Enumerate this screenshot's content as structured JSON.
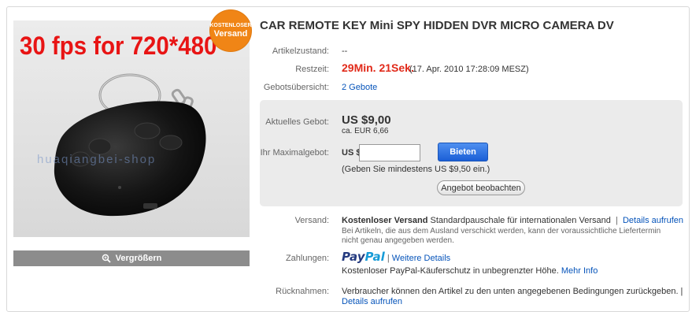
{
  "listing": {
    "title": "CAR REMOTE KEY Mini SPY HIDDEN DVR MICRO CAMERA DV",
    "badge_top": "KOSTENLOSER",
    "badge_bottom": "Versand",
    "image_text": "30 fps for 720*480",
    "watermark": "huaqiangbei-shop",
    "enlarge_label": "Vergrößern"
  },
  "details": {
    "condition_label": "Artikelzustand:",
    "condition_value": "--",
    "time_label": "Restzeit:",
    "time_left": "29Min. 21Sek.",
    "end_time": "(17. Apr. 2010  17:28:09 MESZ)",
    "bids_label": "Gebotsübersicht:",
    "bids_link": "2 Gebote"
  },
  "bid": {
    "current_label": "Aktuelles Gebot:",
    "current_price": "US $9,00",
    "approx_price": "ca. EUR 6,66",
    "max_label": "Ihr Maximalgebot:",
    "currency_prefix": "US $",
    "input_value": "",
    "bid_button": "Bieten",
    "min_hint": "(Geben Sie mindestens US $9,50 ein.)",
    "watch_button": "Angebot beobachten"
  },
  "shipping": {
    "label": "Versand:",
    "bold_text": "Kostenloser Versand",
    "text": "Standardpauschale für internationalen Versand",
    "separator": "|",
    "details_link": "Details aufrufen",
    "note_line1": "Bei Artikeln, die aus dem Ausland verschickt werden, kann der voraussichtliche Liefertermin",
    "note_line2": "nicht genau angegeben werden."
  },
  "payment": {
    "label": "Zahlungen:",
    "paypal_pay": "Pay",
    "paypal_pal": "Pal",
    "separator": "|",
    "more_link": "Weitere Details",
    "protection_text": "Kostenloser PayPal-Käuferschutz in unbegrenzter Höhe.",
    "more_info_link": "Mehr Info"
  },
  "returns": {
    "label": "Rücknahmen:",
    "text": "Verbraucher können den Artikel zu den unten angegebenen Bedingungen zurückgeben. |",
    "details_link": "Details aufrufen"
  },
  "colors": {
    "time_left": "#e12a1a",
    "link": "#0654ba",
    "badge": "#f08516",
    "bid_button": "#1b5fd6",
    "promo_text": "#e81414"
  }
}
